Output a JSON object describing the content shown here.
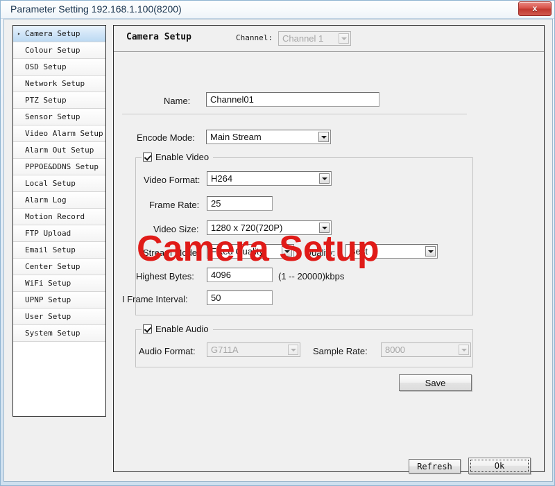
{
  "window": {
    "title": "Parameter Setting 192.168.1.100(8200)",
    "close_label": "x"
  },
  "sidebar": {
    "items": [
      {
        "label": "Camera Setup",
        "selected": true
      },
      {
        "label": "Colour Setup",
        "selected": false
      },
      {
        "label": "OSD Setup",
        "selected": false
      },
      {
        "label": "Network Setup",
        "selected": false
      },
      {
        "label": "PTZ Setup",
        "selected": false
      },
      {
        "label": "Sensor Setup",
        "selected": false
      },
      {
        "label": "Video Alarm Setup",
        "selected": false
      },
      {
        "label": "Alarm Out Setup",
        "selected": false
      },
      {
        "label": "PPPOE&DDNS Setup",
        "selected": false
      },
      {
        "label": "Local Setup",
        "selected": false
      },
      {
        "label": "Alarm Log",
        "selected": false
      },
      {
        "label": "Motion Record",
        "selected": false
      },
      {
        "label": "FTP Upload",
        "selected": false
      },
      {
        "label": "Email Setup",
        "selected": false
      },
      {
        "label": "Center Setup",
        "selected": false
      },
      {
        "label": "WiFi Setup",
        "selected": false
      },
      {
        "label": "UPNP Setup",
        "selected": false
      },
      {
        "label": "User Setup",
        "selected": false
      },
      {
        "label": "System Setup",
        "selected": false
      }
    ],
    "selected_arrow": "▸"
  },
  "panel": {
    "title": "Camera Setup",
    "channel_label": "Channel:",
    "channel_value": "Channel 1",
    "name_label": "Name:",
    "name_value": "Channel01",
    "encode_mode_label": "Encode Mode:",
    "encode_mode_value": "Main Stream"
  },
  "video_group": {
    "legend": "Enable Video",
    "checked": true,
    "video_format_label": "Video Format:",
    "video_format_value": "H264",
    "frame_rate_label": "Frame Rate:",
    "frame_rate_value": "25",
    "video_size_label": "Video Size:",
    "video_size_value": "1280 x 720(720P)",
    "stream_mode_label": "Stream Mode:",
    "stream_mode_value": "Fixed Quality",
    "quality_label": "Quality:",
    "quality_value": "Best",
    "highest_bytes_label": "Highest Bytes:",
    "highest_bytes_value": "4096",
    "highest_bytes_hint": "(1 -- 20000)kbps",
    "iframe_label": "I Frame Interval:",
    "iframe_value": "50"
  },
  "audio_group": {
    "legend": "Enable Audio",
    "checked": true,
    "audio_format_label": "Audio Format:",
    "audio_format_value": "G711A",
    "sample_rate_label": "Sample Rate:",
    "sample_rate_value": "8000"
  },
  "buttons": {
    "save": "Save",
    "refresh": "Refresh",
    "ok": "Ok"
  },
  "watermark": {
    "text": "Camera Setup",
    "color": "#e01b18"
  }
}
